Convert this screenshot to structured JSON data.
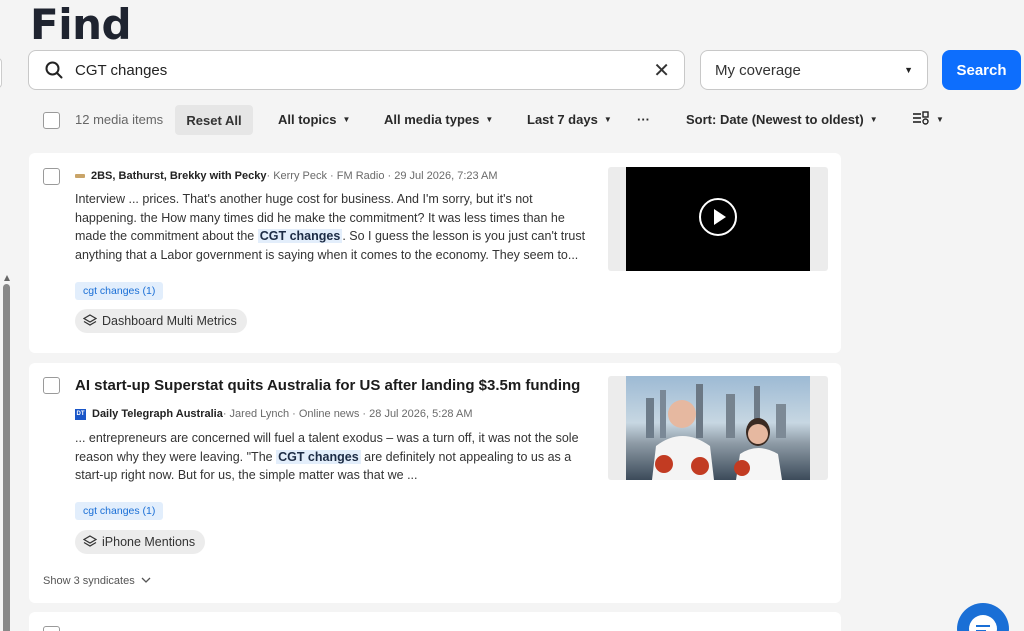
{
  "page": {
    "title": "Find"
  },
  "search": {
    "query": "CGT changes",
    "clear_symbol": "✕",
    "coverage": "My coverage",
    "button_label": "Search"
  },
  "filters": {
    "count": "12 media items",
    "reset": "Reset All",
    "topics": "All topics",
    "media_types": "All media types",
    "date_range": "Last 7 days",
    "more": "···",
    "sort": "Sort: Date (Newest to oldest)",
    "caret": "▼"
  },
  "results": [
    {
      "source": "2BS, Bathurst, Brekky with Pecky",
      "byline": " · Kerry Peck · FM Radio · 29 Jul 2026, 7:23 AM",
      "snippet_pre": "Interview ... prices. That's another huge cost for business. And I'm sorry, but it's not happening. the How many times did he make the commitment? It was less times than he made the commitment about the ",
      "snippet_hl": "CGT changes",
      "snippet_post": ". So I guess the lesson is you just can't trust anything that a Labor government is saying when it comes to the economy. They seem to...",
      "tag": "cgt changes (1)",
      "folder": "Dashboard Multi Metrics"
    },
    {
      "headline": "AI start-up Superstat quits Australia for US after landing $3.5m funding",
      "source": "Daily Telegraph Australia",
      "byline": " · Jared Lynch · Online news · 28 Jul 2026, 5:28 AM",
      "snippet_pre": "... entrepreneurs are concerned will fuel a talent exodus – was a turn off, it was not the sole reason why they were leaving. \"The ",
      "snippet_hl": "CGT changes",
      "snippet_post": " are definitely not appealing to us as a start-up right now. But for us, the simple matter was that we ...",
      "tag": "cgt changes (1)",
      "folder": "iPhone Mentions",
      "syndicates": "Show 3 syndicates",
      "logo_text": "DT"
    }
  ]
}
